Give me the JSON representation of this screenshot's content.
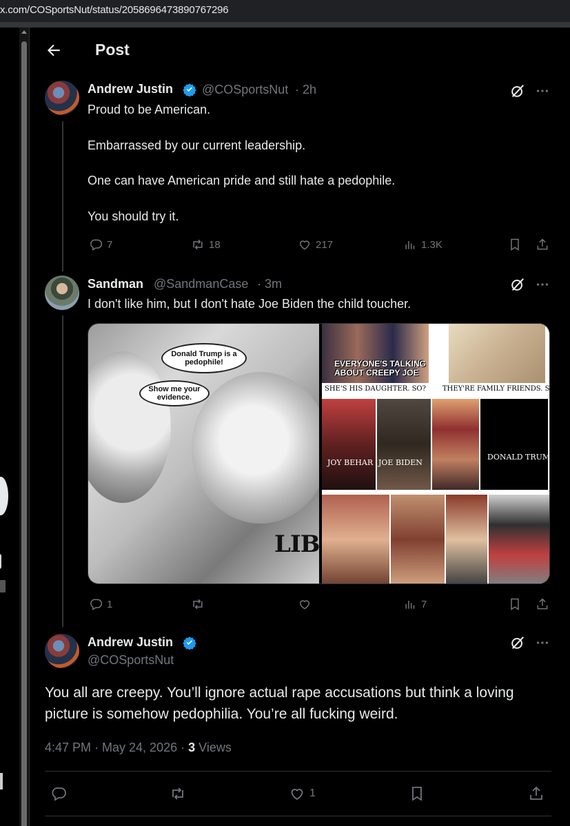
{
  "browser": {
    "url": "x.com/COSportsNut/status/2058696473890767296"
  },
  "header": {
    "title": "Post"
  },
  "tweet1": {
    "name": "Andrew Justin",
    "handle": "@COSportsNut",
    "time": "· 2h",
    "lines": [
      "Proud to be American.",
      "Embarrassed by our current leadership.",
      "One can have American pride and still hate a pedophile.",
      "You should try it."
    ],
    "replies": "7",
    "reposts": "18",
    "likes": "217",
    "views": "1.3K"
  },
  "tweet2": {
    "name": "Sandman",
    "handle": "@SandmanCase",
    "time": "· 3m",
    "text": "I don't like him, but I don't hate Joe Biden the child toucher.",
    "replies": "1",
    "views": "7",
    "image": {
      "bubble1": "Donald Trump is a pedophile!",
      "bubble2": "Show me your evidence.",
      "watermark": "LIBER",
      "talk": "EVERYONE'S TALKING ABOUT CREEPY JOE",
      "cap_daughter": "SHE'S HIS DAUGHTER. SO?",
      "cap_family": "THEY'RE FAMILY FRIENDS. SO?",
      "cap_behar": "JOY BEHAR",
      "cap_biden": "JOE BIDEN",
      "cap_trump": "DONALD TRUMP"
    }
  },
  "main": {
    "name": "Andrew Justin",
    "handle": "@COSportsNut",
    "text": "You all are creepy. You’ll ignore actual rape accusations but think a loving picture is somehow pedophilia. You’re all fucking weird.",
    "time": "4:47 PM · May 24, 2026 ·",
    "views_count": "3",
    "views_label": "Views",
    "likes": "1"
  },
  "colors": {
    "verified": "#1d9bf0",
    "muted": "#71767b",
    "text": "#e7e9ea",
    "background": "#000000"
  }
}
